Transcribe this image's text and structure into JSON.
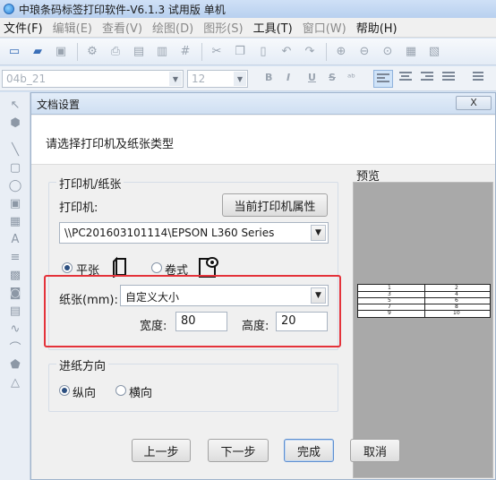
{
  "window": {
    "title": "中琅条码标签打印软件-V6.1.3 试用版 单机"
  },
  "menu": [
    {
      "label": "文件(F)",
      "enabled": true
    },
    {
      "label": "编辑(E)",
      "enabled": false
    },
    {
      "label": "查看(V)",
      "enabled": false
    },
    {
      "label": "绘图(D)",
      "enabled": false
    },
    {
      "label": "图形(S)",
      "enabled": false
    },
    {
      "label": "工具(T)",
      "enabled": true
    },
    {
      "label": "窗口(W)",
      "enabled": false
    },
    {
      "label": "帮助(H)",
      "enabled": true
    }
  ],
  "formatbar": {
    "font_name": "04b_21",
    "font_size": "12"
  },
  "dialog": {
    "title": "文档设置",
    "close_label": "X",
    "header_text": "请选择打印机及纸张类型",
    "printer_group_label": "打印机/纸张",
    "printer_label": "打印机:",
    "printer_props_button": "当前打印机属性",
    "printer_value": "\\\\PC201603101114\\EPSON L360 Series",
    "paper_type_flat": "平张",
    "paper_type_roll": "卷式",
    "paper_label": "纸张(mm):",
    "paper_value": "自定义大小",
    "width_label": "宽度:",
    "width_value": "80",
    "height_label": "高度:",
    "height_value": "20",
    "feed_group_label": "进纸方向",
    "feed_portrait": "纵向",
    "feed_landscape": "横向",
    "preview_label": "预览",
    "preview_numbers": {
      "left": [
        "1",
        "3",
        "5",
        "7",
        "9"
      ],
      "right": [
        "2",
        "4",
        "6",
        "8",
        "10"
      ]
    },
    "buttons": {
      "prev": "上一步",
      "next": "下一步",
      "finish": "完成",
      "cancel": "取消"
    }
  },
  "state": {
    "paper_type_selected": "平张",
    "feed_selected": "纵向"
  },
  "colors": {
    "highlight_border": "#e4323a",
    "title_gradient": "#cfe0f6",
    "preview_bg": "#a9a9a9"
  }
}
